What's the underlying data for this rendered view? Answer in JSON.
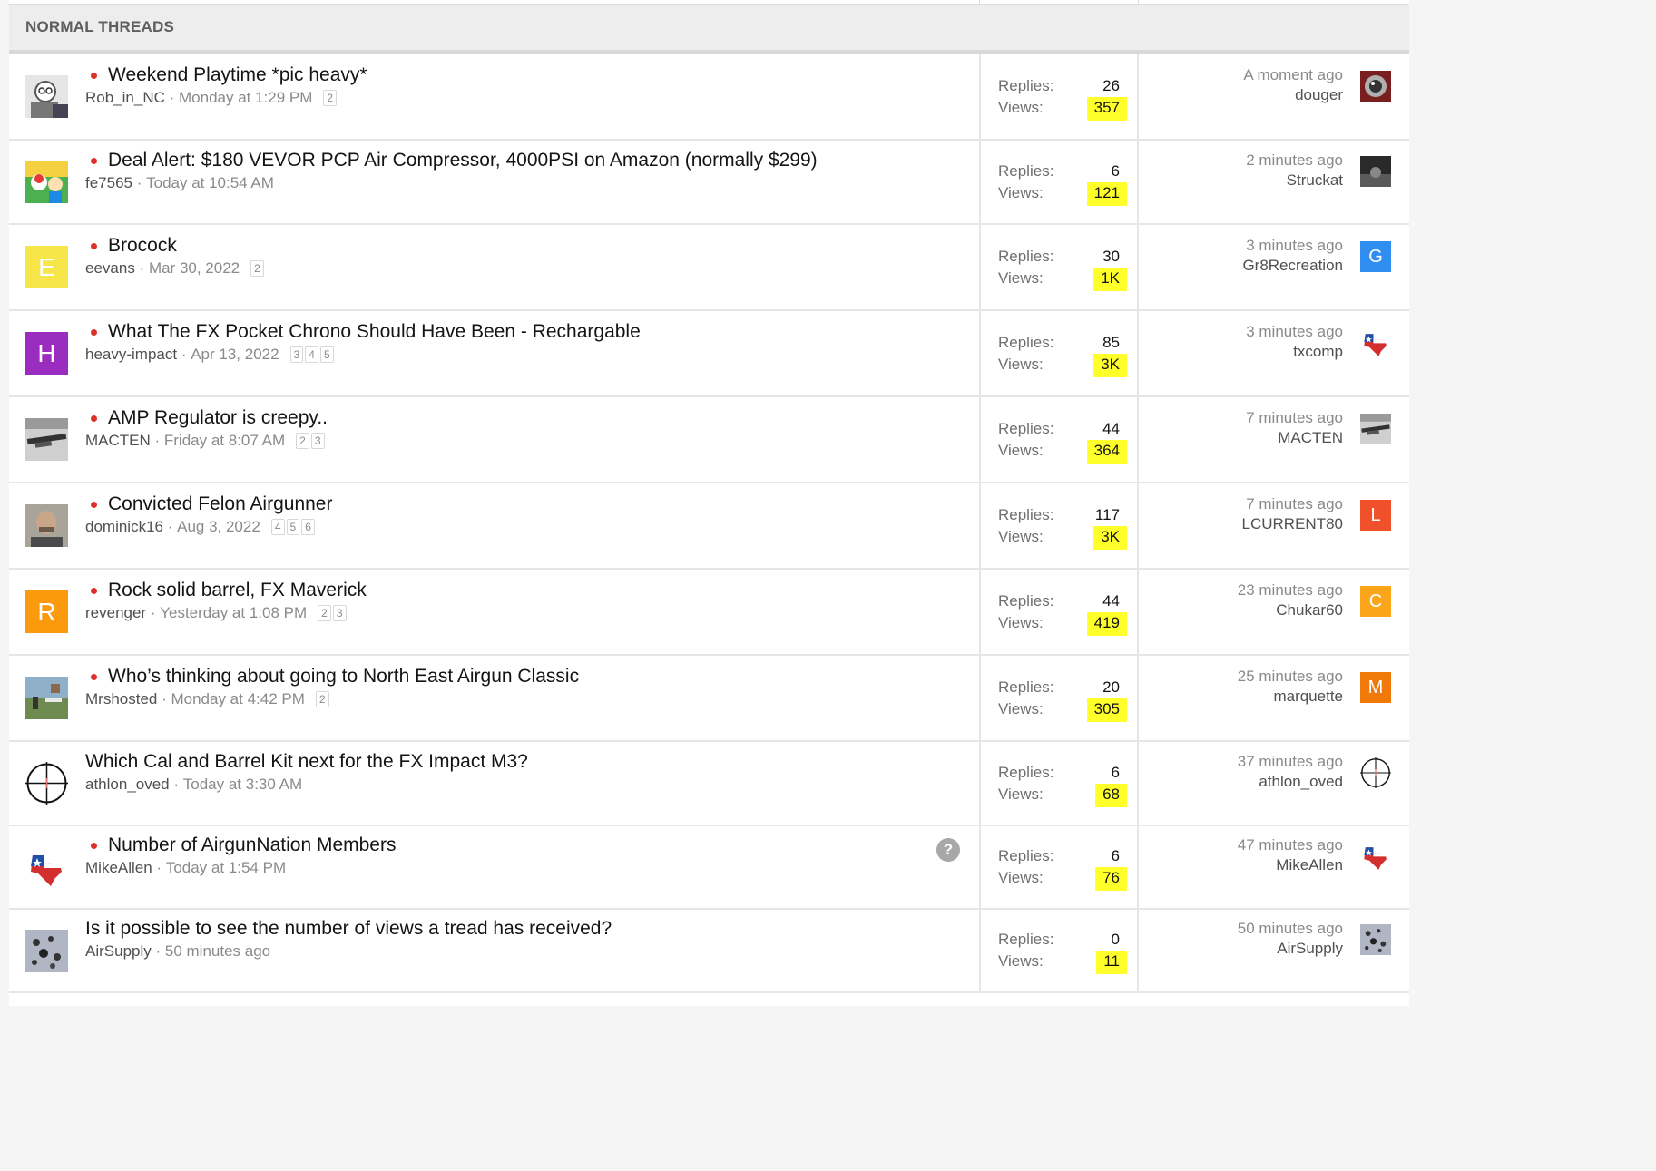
{
  "section": {
    "title": "NORMAL THREADS"
  },
  "labels": {
    "replies": "Replies:",
    "views": "Views:"
  },
  "colors": {
    "highlight": "#ffff2a",
    "unread_dot": "#e0302a"
  },
  "threads": [
    {
      "title": "Weekend Playtime *pic heavy*",
      "unread": true,
      "author": "Rob_in_NC",
      "date": "Monday at 1:29 PM",
      "pages": [
        "2"
      ],
      "replies": "26",
      "views": "357",
      "last_time": "A moment ago",
      "last_user": "douger",
      "avatar": {
        "type": "photo-person",
        "letter": "",
        "color": "#d9d9d9"
      },
      "last_avatar": {
        "type": "photo-red",
        "letter": "",
        "color": "#8b2a2a"
      }
    },
    {
      "title": "Deal Alert: $180 VEVOR PCP Air Compressor, 4000PSI on Amazon (normally $299)",
      "unread": true,
      "author": "fe7565",
      "date": "Today at 10:54 AM",
      "pages": [],
      "replies": "6",
      "views": "121",
      "last_time": "2 minutes ago",
      "last_user": "Struckat",
      "avatar": {
        "type": "photo-cartoon",
        "letter": "",
        "color": "#3a9a3a"
      },
      "last_avatar": {
        "type": "photo-dark",
        "letter": "",
        "color": "#3a3a3a"
      }
    },
    {
      "title": "Brocock",
      "unread": true,
      "author": "eevans",
      "date": "Mar 30, 2022",
      "pages": [
        "2"
      ],
      "replies": "30",
      "views": "1K",
      "last_time": "3 minutes ago",
      "last_user": "Gr8Recreation",
      "avatar": {
        "type": "letter",
        "letter": "E",
        "color": "#f6e64a"
      },
      "last_avatar": {
        "type": "letter",
        "letter": "G",
        "color": "#2f8ef0"
      }
    },
    {
      "title": "What The FX Pocket Chrono Should Have Been - Rechargable",
      "unread": true,
      "author": "heavy-impact",
      "date": "Apr 13, 2022",
      "pages": [
        "3",
        "4",
        "5"
      ],
      "replies": "85",
      "views": "3K",
      "last_time": "3 minutes ago",
      "last_user": "txcomp",
      "avatar": {
        "type": "letter",
        "letter": "H",
        "color": "#9b2cc0"
      },
      "last_avatar": {
        "type": "texas",
        "letter": "",
        "color": "#ffffff"
      }
    },
    {
      "title": "AMP Regulator is creepy..",
      "unread": true,
      "author": "MACTEN",
      "date": "Friday at 8:07 AM",
      "pages": [
        "2",
        "3"
      ],
      "replies": "44",
      "views": "364",
      "last_time": "7 minutes ago",
      "last_user": "MACTEN",
      "avatar": {
        "type": "photo-rifle",
        "letter": "",
        "color": "#6b6b6b"
      },
      "last_avatar": {
        "type": "photo-rifle",
        "letter": "",
        "color": "#6b6b6b"
      }
    },
    {
      "title": "Convicted Felon Airgunner",
      "unread": true,
      "author": "dominick16",
      "date": "Aug 3, 2022",
      "pages": [
        "4",
        "5",
        "6"
      ],
      "replies": "117",
      "views": "3K",
      "last_time": "7 minutes ago",
      "last_user": "LCURRENT80",
      "avatar": {
        "type": "photo-face",
        "letter": "",
        "color": "#8f8a80"
      },
      "last_avatar": {
        "type": "letter",
        "letter": "L",
        "color": "#f0512a"
      }
    },
    {
      "title": "Rock solid barrel, FX Maverick",
      "unread": true,
      "author": "revenger",
      "date": "Yesterday at 1:08 PM",
      "pages": [
        "2",
        "3"
      ],
      "replies": "44",
      "views": "419",
      "last_time": "23 minutes ago",
      "last_user": "Chukar60",
      "avatar": {
        "type": "letter",
        "letter": "R",
        "color": "#fb9a0c"
      },
      "last_avatar": {
        "type": "letter",
        "letter": "C",
        "color": "#fba61a"
      }
    },
    {
      "title": "Who’s thinking about going to North East Airgun Classic",
      "unread": true,
      "author": "Mrshosted",
      "date": "Monday at 4:42 PM",
      "pages": [
        "2"
      ],
      "replies": "20",
      "views": "305",
      "last_time": "25 minutes ago",
      "last_user": "marquette",
      "avatar": {
        "type": "photo-range",
        "letter": "",
        "color": "#7a8a6a"
      },
      "last_avatar": {
        "type": "letter",
        "letter": "M",
        "color": "#f0790a"
      }
    },
    {
      "title": "Which Cal and Barrel Kit next for the FX Impact M3?",
      "unread": false,
      "author": "athlon_oved",
      "date": "Today at 3:30 AM",
      "pages": [],
      "replies": "6",
      "views": "68",
      "last_time": "37 minutes ago",
      "last_user": "athlon_oved",
      "avatar": {
        "type": "crosshair",
        "letter": "",
        "color": "#ffffff"
      },
      "last_avatar": {
        "type": "crosshair",
        "letter": "",
        "color": "#ffffff"
      }
    },
    {
      "title": "Number of AirgunNation Members",
      "unread": true,
      "author": "MikeAllen",
      "date": "Today at 1:54 PM",
      "pages": [],
      "replies": "6",
      "views": "76",
      "last_time": "47 minutes ago",
      "last_user": "MikeAllen",
      "help": "?",
      "avatar": {
        "type": "texas",
        "letter": "",
        "color": "#ffffff"
      },
      "last_avatar": {
        "type": "texas",
        "letter": "",
        "color": "#ffffff"
      }
    },
    {
      "title": "Is it possible to see the number of views a tread has received?",
      "unread": false,
      "author": "AirSupply",
      "date": "50 minutes ago",
      "pages": [],
      "replies": "0",
      "views": "11",
      "last_time": "50 minutes ago",
      "last_user": "AirSupply",
      "avatar": {
        "type": "photo-dots",
        "letter": "",
        "color": "#9aa0b0"
      },
      "last_avatar": {
        "type": "photo-dots",
        "letter": "",
        "color": "#9aa0b0"
      }
    }
  ]
}
